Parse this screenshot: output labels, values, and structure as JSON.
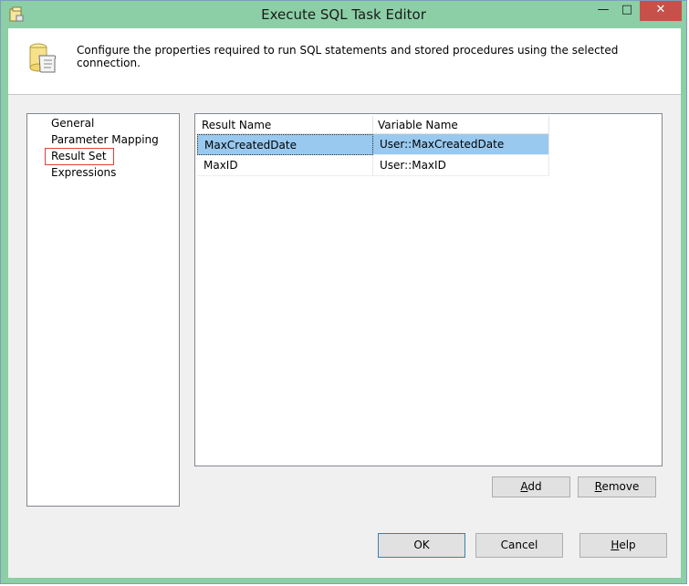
{
  "window": {
    "title": "Execute SQL Task Editor",
    "minimize_glyph": "—",
    "maximize_glyph": "□",
    "close_glyph": "✕"
  },
  "header": {
    "description": "Configure the properties required to run SQL statements and stored procedures using the selected connection.",
    "icon": "sql-task-scroll-icon"
  },
  "nav": {
    "items": [
      {
        "label": "General"
      },
      {
        "label": "Parameter Mapping"
      },
      {
        "label": "Result Set",
        "selected": true
      },
      {
        "label": "Expressions"
      }
    ]
  },
  "grid": {
    "columns": [
      "Result Name",
      "Variable Name"
    ],
    "rows": [
      {
        "result_name": "MaxCreatedDate",
        "variable_name": "User::MaxCreatedDate",
        "selected": true
      },
      {
        "result_name": "MaxID",
        "variable_name": "User::MaxID",
        "selected": false
      }
    ]
  },
  "buttons": {
    "add": {
      "prefix": "",
      "underline": "A",
      "suffix": "dd"
    },
    "remove": {
      "prefix": "",
      "underline": "R",
      "suffix": "emove"
    },
    "ok": {
      "label": "OK"
    },
    "cancel": {
      "label": "Cancel"
    },
    "help": {
      "prefix": "",
      "underline": "H",
      "suffix": "elp"
    }
  },
  "colors": {
    "titlebar": "#8ccfa6",
    "close_button": "#c7504a",
    "selection": "#99c9ef",
    "highlight_box": "#e04040"
  }
}
